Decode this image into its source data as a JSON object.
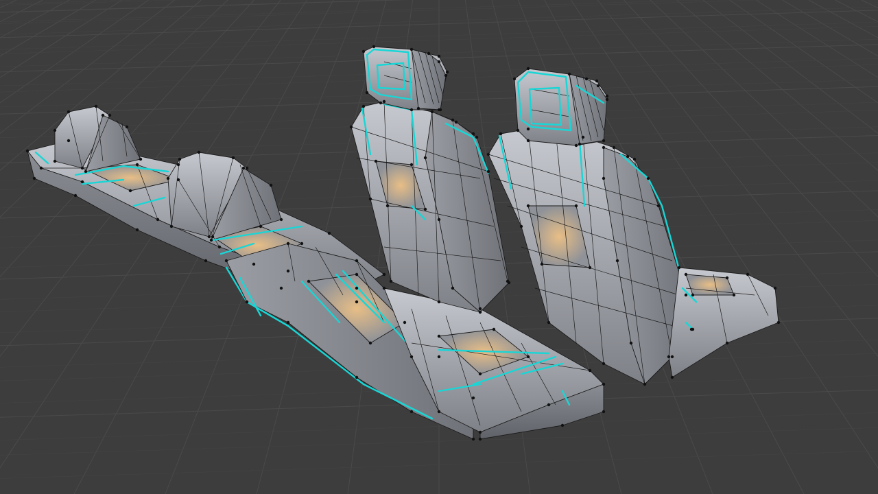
{
  "viewport": {
    "background": "#3d3d3d",
    "grid_color": "#4a4a4a",
    "mesh_color": "#8d9096",
    "mesh_highlight": "#c9ccd2",
    "warm_highlight": "#e0b27a",
    "seam_color": "#19d6d6",
    "vertex_color": "#111111",
    "icons": [
      "seat-mesh",
      "headrest-mesh",
      "bench-mesh"
    ]
  }
}
